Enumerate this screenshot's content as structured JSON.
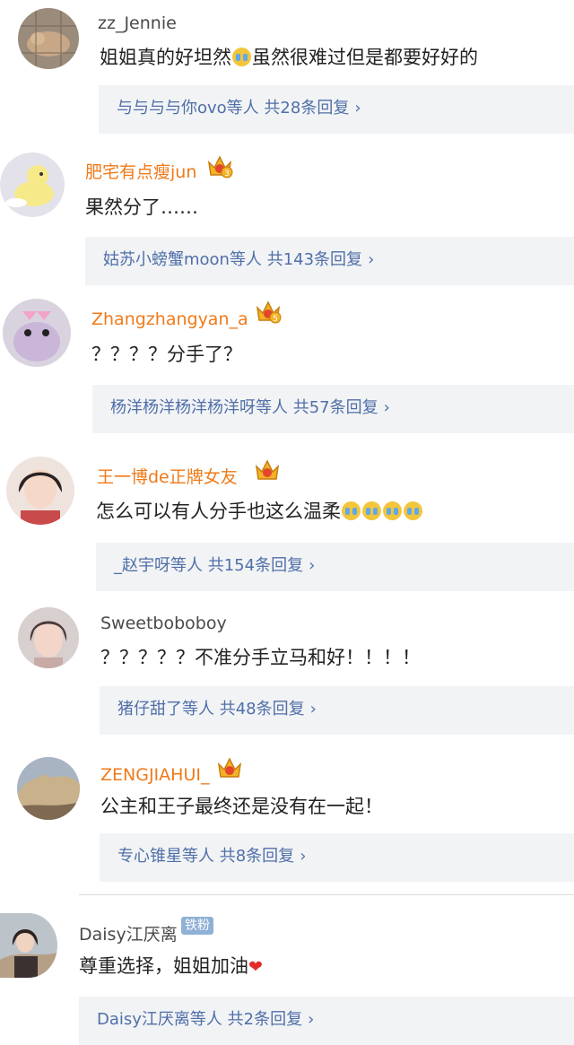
{
  "comments": [
    {
      "username": "zz_Jennie",
      "text_parts": [
        "姐姐真的好坦然",
        "虽然很难过但是都要好好的"
      ],
      "reply_summary": "与与与与你ovo等人",
      "reply_count": "共28条回复",
      "name_style": "gray",
      "badge": "none"
    },
    {
      "username": "肥宅有点瘦jun",
      "text": "果然分了……",
      "reply_summary": "姑苏小螃蟹moon等人",
      "reply_count": "共143条回复",
      "name_style": "orange",
      "badge": "crown",
      "crown_level": "3"
    },
    {
      "username": "Zhangzhangyan_a",
      "text": "？？？？分手了？",
      "reply_summary": "杨洋杨洋杨洋杨洋呀等人",
      "reply_count": "共57条回复",
      "name_style": "orange",
      "badge": "crown",
      "crown_level": "5"
    },
    {
      "username": "王一博de正牌女友",
      "text": "怎么可以有人分手也这么温柔",
      "reply_summary": "_赵宇呀等人",
      "reply_count": "共154条回复",
      "name_style": "orange",
      "badge": "crown",
      "crown_level": ""
    },
    {
      "username": "Sweetboboboy",
      "text": "？？？？？不准分手立马和好！！！！",
      "reply_summary": "猪仔甜了等人",
      "reply_count": "共48条回复",
      "name_style": "gray",
      "badge": "none"
    },
    {
      "username": "ZENGJIAHUI_",
      "text": "公主和王子最终还是没有在一起！",
      "reply_summary": "专心锥星等人",
      "reply_count": "共8条回复",
      "name_style": "orange",
      "badge": "crown",
      "crown_level": ""
    },
    {
      "username": "Daisy江厌离",
      "text": "尊重选择，姐姐加油",
      "reply_summary": "Daisy江厌离等人",
      "reply_count": "共2条回复",
      "name_style": "gray",
      "badge": "fan",
      "fan_badge_label": "铁粉"
    }
  ],
  "chevron": "›",
  "colors": {
    "reply_link": "#4f6fa8",
    "vip_name": "#ef7a1a",
    "reply_bg": "#f2f3f5"
  },
  "icons": {
    "crying_emoji": "crying-emoji-icon",
    "heart": "heart-icon",
    "crown": "vip-crown-icon"
  }
}
